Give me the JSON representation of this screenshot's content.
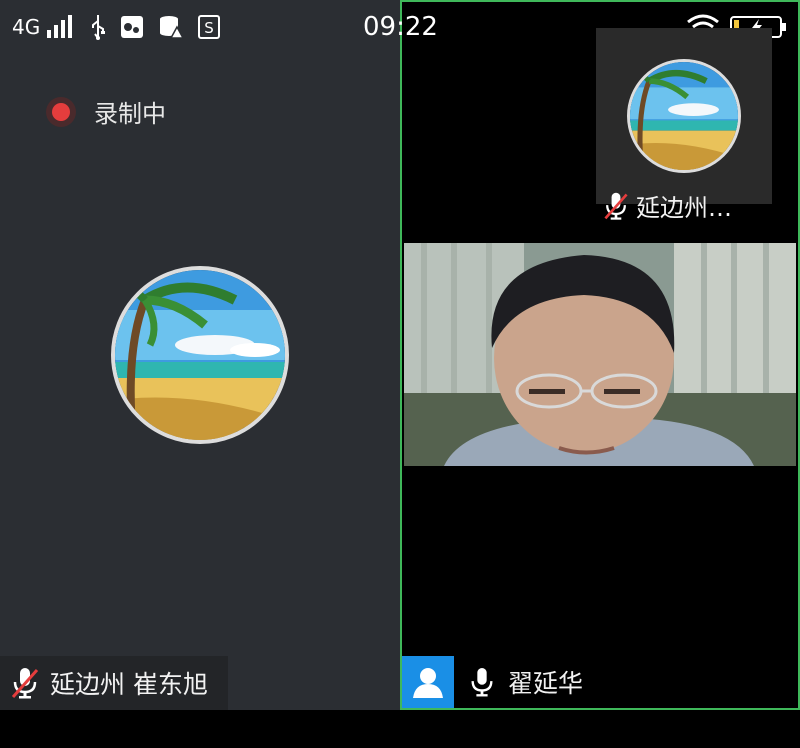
{
  "status_bar": {
    "network": "4G",
    "time": "09:22",
    "colors": {
      "battery_fill": "#f2c53d"
    }
  },
  "recording": {
    "label": "录制中",
    "colors": {
      "dot": "#e53d3d"
    }
  },
  "participants": {
    "left": {
      "name": "延边州 崔东旭",
      "mic_icon": "mic-muted-icon"
    },
    "pip": {
      "name": "延边州…",
      "mic_icon": "mic-muted-icon"
    },
    "main_video": {
      "name": "翟延华",
      "mic_icon": "mic-icon",
      "avatar_icon": "user-icon"
    }
  },
  "colors": {
    "left_pane_bg": "#2b2e33",
    "active_border": "#3fb85a",
    "user_badge": "#1a8fe6"
  }
}
